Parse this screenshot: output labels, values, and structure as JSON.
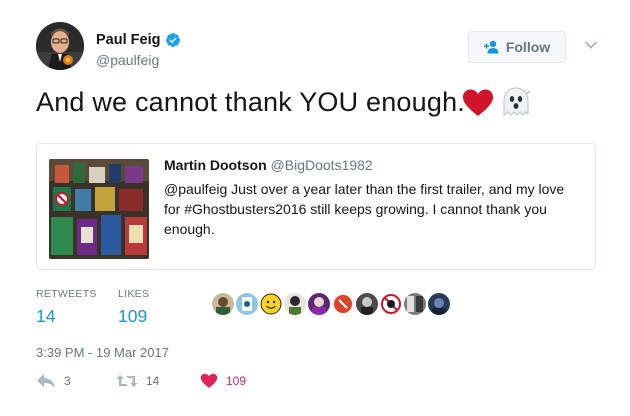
{
  "author": {
    "name": "Paul Feig",
    "handle": "@paulfeig",
    "verified": true
  },
  "follow_button": {
    "label": "Follow",
    "icon": "add-user-icon"
  },
  "more_menu": {
    "icon": "chevron-down-icon"
  },
  "tweet": {
    "text": "And we cannot thank YOU enough.",
    "emojis": [
      "red-heart",
      "ghost"
    ]
  },
  "quoted_tweet": {
    "name": "Martin Dootson",
    "handle": "@BigDoots1982",
    "text": "@paulfeig Just over a year later than the first trailer, and my love for #Ghostbusters2016 still keeps growing. I cannot thank you enough."
  },
  "stats": {
    "retweets_label": "RETWEETS",
    "retweets_value": "14",
    "likes_label": "LIKES",
    "likes_value": "109"
  },
  "likers": [
    "liker-1",
    "liker-2",
    "liker-3",
    "liker-4",
    "liker-5",
    "liker-6",
    "liker-7",
    "liker-8",
    "liker-9"
  ],
  "timestamp": "3:39 PM - 19 Mar 2017",
  "actions": {
    "reply_count": "3",
    "retweet_count": "14",
    "like_count": "109"
  },
  "colors": {
    "link_blue": "#1b95e0",
    "like_red": "#e0245e",
    "muted_gray": "#657786",
    "verified_blue": "#1da1f2"
  }
}
